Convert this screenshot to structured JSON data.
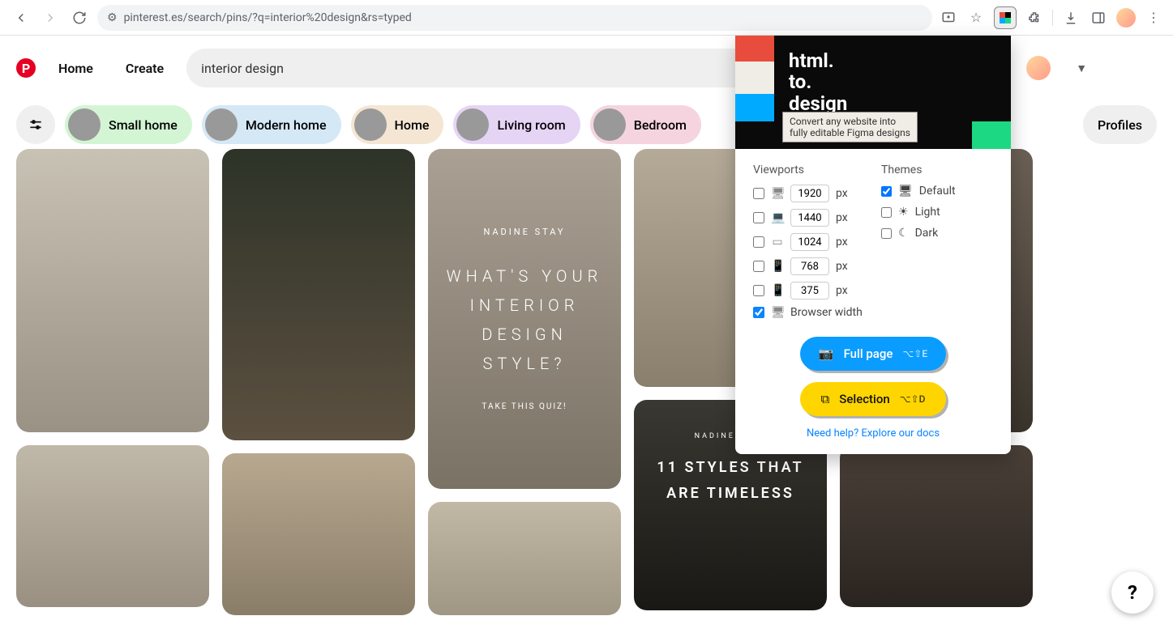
{
  "browser": {
    "url": "pinterest.es/search/pins/?q=interior%20design&rs=typed"
  },
  "header": {
    "home": "Home",
    "create": "Create",
    "search_value": "interior design"
  },
  "chips": [
    {
      "label": "Small home",
      "color": "green"
    },
    {
      "label": "Modern home",
      "color": "blue"
    },
    {
      "label": "Home",
      "color": "peach"
    },
    {
      "label": "Living room",
      "color": "purple"
    },
    {
      "label": "Bedroom",
      "color": "pink"
    },
    {
      "label": "Profiles",
      "color": "grey"
    }
  ],
  "pins": {
    "quiz": {
      "subtitle": "NADINE STAY",
      "title": "WHAT'S YOUR INTERIOR DESIGN STYLE?",
      "cta": "TAKE THIS QUIZ!"
    },
    "timeless": {
      "subtitle": "NADINE STAY",
      "title": "11 STYLES THAT ARE TIMELESS"
    }
  },
  "extension": {
    "title_l1": "html.",
    "title_l2": "to.",
    "title_l3": "design",
    "tagline_l1": "Convert any website into",
    "tagline_l2": "fully editable Figma designs",
    "viewports_label": "Viewports",
    "themes_label": "Themes",
    "viewports": [
      {
        "value": "1920",
        "unit": "px",
        "checked": false
      },
      {
        "value": "1440",
        "unit": "px",
        "checked": false
      },
      {
        "value": "1024",
        "unit": "px",
        "checked": false
      },
      {
        "value": "768",
        "unit": "px",
        "checked": false
      },
      {
        "value": "375",
        "unit": "px",
        "checked": false
      }
    ],
    "browser_width": {
      "label": "Browser width",
      "checked": true
    },
    "themes": [
      {
        "label": "Default",
        "checked": true
      },
      {
        "label": "Light",
        "checked": false
      },
      {
        "label": "Dark",
        "checked": false
      }
    ],
    "fullpage_btn": "Full page",
    "fullpage_kbd": "⌥⇧E",
    "selection_btn": "Selection",
    "selection_kbd": "⌥⇧D",
    "help": "Need help? Explore our docs"
  },
  "fab": "?"
}
